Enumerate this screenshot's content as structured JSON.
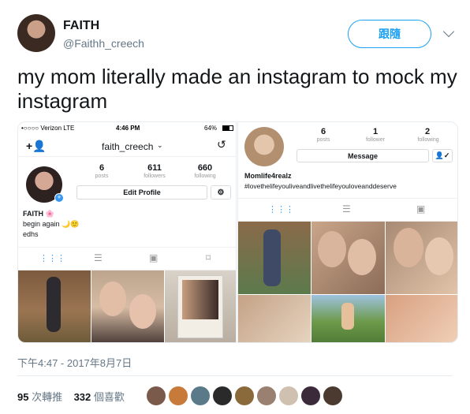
{
  "tweet": {
    "display_name": "FAITH",
    "handle": "@Faithh_creech",
    "follow_label": "跟隨",
    "text": "my mom literally made an instagram to mock my instagram",
    "timestamp": "下午4:47 - 2017年8月7日",
    "retweets": "95",
    "retweets_label": "次轉推",
    "likes": "332",
    "likes_label": "個喜歡"
  },
  "left_shot": {
    "status_carrier": "•○○○○ Verizon  LTE",
    "status_time": "4:46 PM",
    "status_battery": "64%",
    "username": "faith_creech",
    "posts": "6",
    "posts_label": "posts",
    "followers": "611",
    "followers_label": "followers",
    "following": "660",
    "following_label": "following",
    "edit_profile": "Edit Profile",
    "bio_name": "FAITH 🌸",
    "bio_line1": "begin again 🌙🙂",
    "bio_line2": "edhs"
  },
  "right_shot": {
    "posts": "6",
    "posts_label": "posts",
    "followers": "1",
    "followers_label": "follower",
    "following": "2",
    "following_label": "following",
    "message": "Message",
    "bio_name": "Momlife4realz",
    "bio_tag": "#lovethelifeyouliveandlivethelifeyouloveanddeserve"
  },
  "colors": {
    "accent": "#1da1f2",
    "ig_blue": "#3897f0",
    "text_muted": "#657786"
  }
}
